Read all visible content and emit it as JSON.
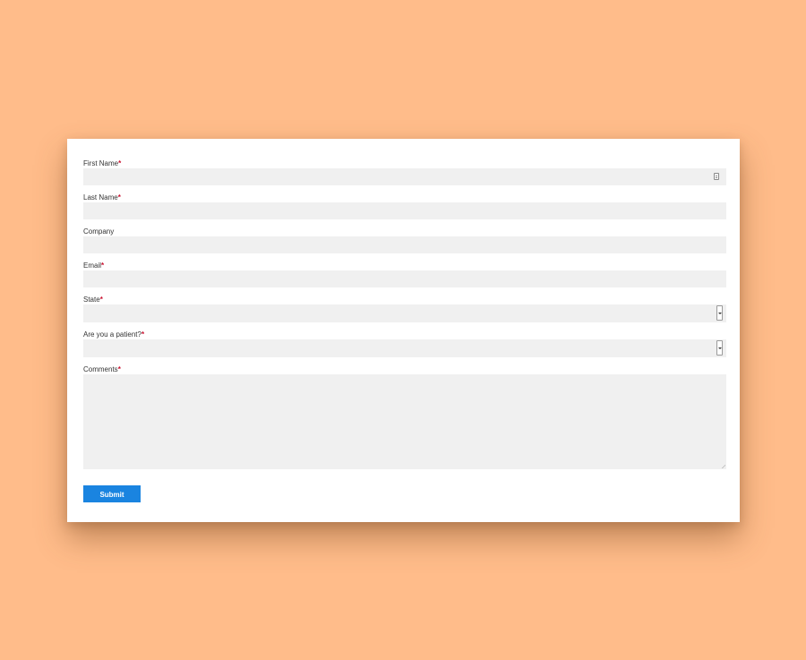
{
  "form": {
    "fields": {
      "first_name": {
        "label": "First Name",
        "required": "*",
        "value": ""
      },
      "last_name": {
        "label": "Last Name",
        "required": "*",
        "value": ""
      },
      "company": {
        "label": "Company",
        "value": ""
      },
      "email": {
        "label": "Email",
        "required": "*",
        "value": ""
      },
      "state": {
        "label": "State",
        "required": "*",
        "selected": ""
      },
      "patient": {
        "label": "Are you a patient?",
        "required": "*",
        "selected": ""
      },
      "comments": {
        "label": "Comments",
        "required": "*",
        "value": ""
      }
    },
    "submit_label": "Submit"
  },
  "colors": {
    "page_background": "#FFBC8A",
    "card_background": "#FFFFFF",
    "field_background": "#F0F0F0",
    "required_marker": "#C8102E",
    "submit_button": "#1A84E0"
  },
  "icons": {
    "autofill": "contact-card-icon",
    "select": "chevron-down-icon"
  }
}
